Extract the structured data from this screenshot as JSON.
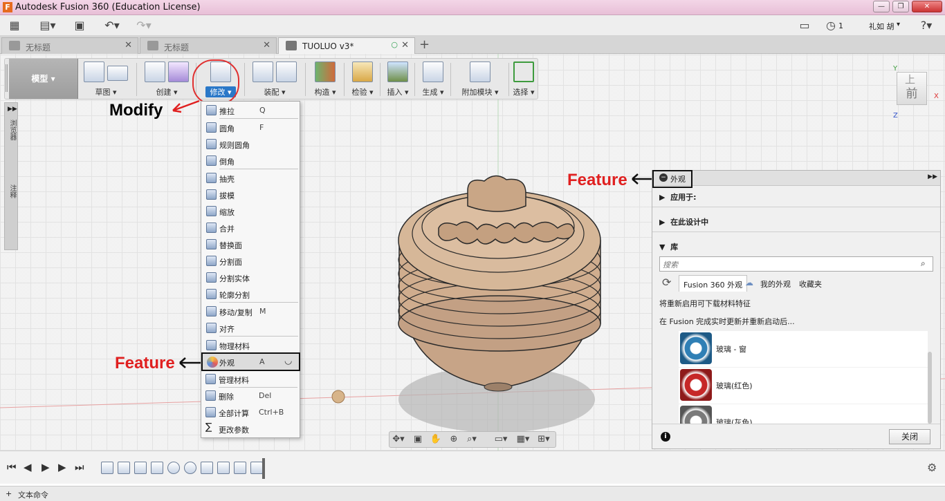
{
  "window": {
    "title": "Autodesk Fusion 360 (Education License)",
    "app_icon": "F"
  },
  "quickbar": {
    "user": "礼如 胡",
    "jobs_count": "1"
  },
  "tabs": [
    {
      "label": "无标题",
      "active": false
    },
    {
      "label": "无标题",
      "active": false
    },
    {
      "label": "TUOLUO v3*",
      "active": true
    }
  ],
  "toolbar": {
    "workspace": "模型",
    "groups": [
      "草图",
      "创建",
      "修改",
      "装配",
      "构造",
      "检验",
      "插入",
      "生成",
      "附加模块",
      "选择"
    ]
  },
  "viewcube": {
    "face": "前",
    "top": "上"
  },
  "left_panel": [
    "浏览器",
    "注释"
  ],
  "annotations": {
    "modify": "Modify",
    "feature_menu": "Feature",
    "feature_panel": "Feature"
  },
  "menu": {
    "items": [
      {
        "label": "推拉",
        "key": "Q"
      },
      {
        "label": "圆角",
        "key": "F"
      },
      {
        "label": "规则圆角",
        "key": ""
      },
      {
        "label": "倒角",
        "key": ""
      },
      {
        "label": "抽壳",
        "key": ""
      },
      {
        "label": "拔模",
        "key": ""
      },
      {
        "label": "缩放",
        "key": ""
      },
      {
        "label": "合并",
        "key": ""
      },
      {
        "label": "替换面",
        "key": ""
      },
      {
        "label": "分割面",
        "key": ""
      },
      {
        "label": "分割实体",
        "key": ""
      },
      {
        "label": "轮廓分割",
        "key": ""
      },
      {
        "label": "移动/复制",
        "key": "M"
      },
      {
        "label": "对齐",
        "key": ""
      },
      {
        "label": "物理材料",
        "key": ""
      },
      {
        "label": "外观",
        "key": "A"
      },
      {
        "label": "管理材料",
        "key": ""
      },
      {
        "label": "删除",
        "key": "Del"
      },
      {
        "label": "全部计算",
        "key": "Ctrl+B"
      },
      {
        "label": "更改参数",
        "key": ""
      }
    ]
  },
  "appearance_panel": {
    "title": "外观",
    "apply_to": "应用于:",
    "in_design": "在此设计中",
    "library": "库",
    "search_placeholder": "搜索",
    "tabs": [
      "Fusion 360 外观",
      "我的外观",
      "收藏夹"
    ],
    "msg1": "将重新启用可下载材料特征",
    "msg2": "在 Fusion 完成实时更新并重新启动后...",
    "materials": [
      {
        "name": "玻璃 - 窗",
        "color": "#2f7fb5"
      },
      {
        "name": "玻璃(红色)",
        "color": "#c62828"
      },
      {
        "name": "玻璃(灰色)",
        "color": "#7a7a7a"
      }
    ],
    "close": "关闭"
  },
  "command_bar": {
    "label": "文本命令"
  }
}
